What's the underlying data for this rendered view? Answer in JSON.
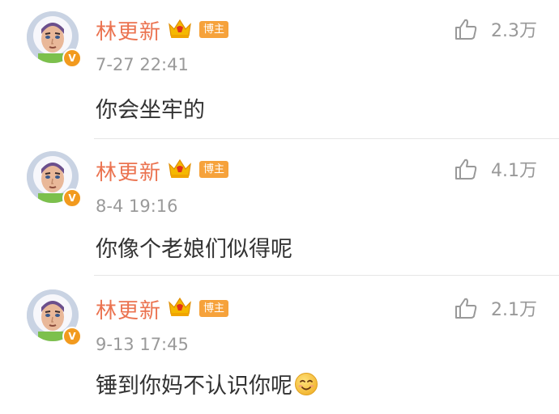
{
  "comments": [
    {
      "username": "林更新",
      "author_badge": "博主",
      "likes": "2.3万",
      "time": "7-27 22:41",
      "text": "你会坐牢的",
      "emoji": null
    },
    {
      "username": "林更新",
      "author_badge": "博主",
      "likes": "4.1万",
      "time": "8-4 19:16",
      "text": "你像个老娘们似得呢",
      "emoji": null
    },
    {
      "username": "林更新",
      "author_badge": "博主",
      "likes": "2.1万",
      "time": "9-13 17:45",
      "text": "锤到你妈不认识你呢",
      "emoji": "smile-emoji"
    }
  ],
  "icons": {
    "like": "thumbs-up-outline-icon",
    "verified": "verified-v-icon",
    "vip": "crown-icon"
  },
  "colors": {
    "username": "#eb7350",
    "badge": "#f6a23b",
    "verified": "#f29a1e",
    "meta": "#999999",
    "text": "#333333"
  }
}
